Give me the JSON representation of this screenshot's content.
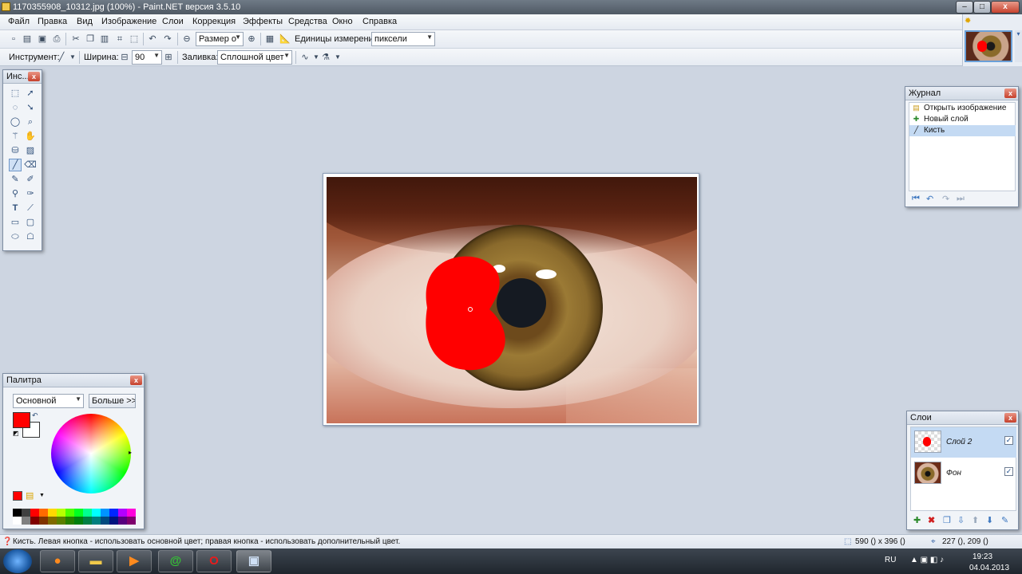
{
  "window": {
    "title": "1170355908_10312.jpg (100%) - Paint.NET версия 3.5.10",
    "minimize_glyph": "–",
    "maximize_glyph": "□",
    "close_glyph": "x"
  },
  "menu": [
    "Файл",
    "Правка",
    "Вид",
    "Изображение",
    "Слои",
    "Коррекция",
    "Эффекты",
    "Средства",
    "Окно",
    "Справка"
  ],
  "toolbar1": {
    "zoom_combo": "Размер о",
    "units_label": "Единицы измерения:",
    "units_value": "пиксели",
    "icons": [
      "new-icon",
      "open-icon",
      "save-icon",
      "print-icon",
      "cut-icon",
      "copy-icon",
      "paste-icon",
      "crop-icon",
      "deselect-icon",
      "undo-icon",
      "redo-icon",
      "zoom-out-icon",
      "zoom-in-icon",
      "grid-icon",
      "ruler-icon"
    ]
  },
  "toolbar2": {
    "tool_label": "Инструмент:",
    "width_label": "Ширина:",
    "width_value": "90",
    "fill_label": "Заливка:",
    "fill_value": "Сплошной цвет"
  },
  "tools_panel": {
    "title": "Инс...",
    "selected_tool": "brush-tool"
  },
  "history_panel": {
    "title": "Журнал",
    "items": [
      {
        "label": "Открыть изображение",
        "icon": "open-image-icon"
      },
      {
        "label": "Новый слой",
        "icon": "new-layer-icon"
      },
      {
        "label": "Кисть",
        "icon": "brush-icon",
        "selected": true
      }
    ]
  },
  "palette_panel": {
    "title": "Палитра",
    "mode": "Основной",
    "more_button": "Больше >>",
    "primary_color": "#ff0000",
    "secondary_color": "#ffffff"
  },
  "layers_panel": {
    "title": "Слои",
    "layers": [
      {
        "name": "Слой 2",
        "visible": true,
        "selected": true
      },
      {
        "name": "Фон",
        "visible": true,
        "selected": false
      }
    ]
  },
  "statusbar": {
    "hint": "Кисть. Левая кнопка - использовать основной цвет; правая кнопка - использовать дополнительный цвет.",
    "image_size": "590 () x 396 ()",
    "cursor_pos": "227 (), 209 ()"
  },
  "taskbar": {
    "apps": [
      "firefox",
      "explorer",
      "media-player",
      "icq",
      "opera",
      "paint-net"
    ],
    "lang": "RU",
    "time": "19:23",
    "date": "04.04.2013"
  },
  "colors": {
    "accent": "#3d77c0",
    "selection": "#c4daf3",
    "workspace": "#cdd5e1"
  }
}
